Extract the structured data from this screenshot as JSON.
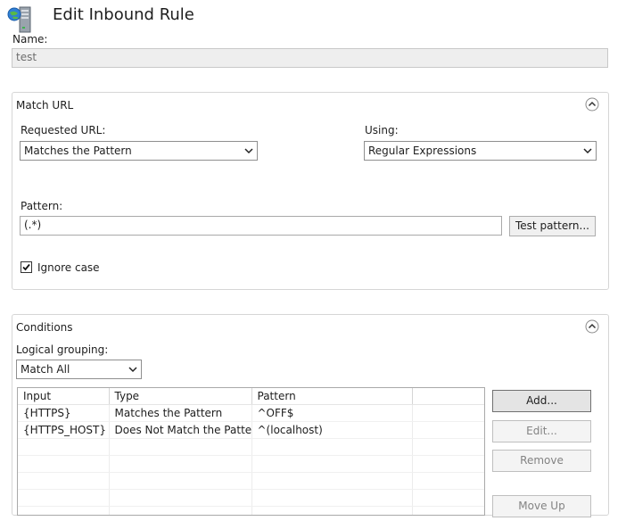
{
  "window": {
    "title": "Edit Inbound Rule",
    "icon": "globe-server-icon"
  },
  "name": {
    "label": "Name:",
    "value": "test"
  },
  "match_url": {
    "header": "Match URL",
    "requested_url_label": "Requested URL:",
    "requested_url_value": "Matches the Pattern",
    "using_label": "Using:",
    "using_value": "Regular Expressions",
    "pattern_label": "Pattern:",
    "pattern_value": "(.*)",
    "test_pattern_button": "Test pattern...",
    "ignore_case_label": "Ignore case",
    "ignore_case_checked": true
  },
  "conditions": {
    "header": "Conditions",
    "logical_grouping_label": "Logical grouping:",
    "logical_grouping_value": "Match All",
    "columns": [
      "Input",
      "Type",
      "Pattern"
    ],
    "rows": [
      {
        "input": "{HTTPS}",
        "type": "Matches the Pattern",
        "pattern": "^OFF$"
      },
      {
        "input": "{HTTPS_HOST}",
        "type": "Does Not Match the Pattern",
        "pattern": "^(localhost)"
      }
    ],
    "buttons": {
      "add": "Add...",
      "edit": "Edit...",
      "remove": "Remove",
      "move_up": "Move Up"
    }
  }
}
